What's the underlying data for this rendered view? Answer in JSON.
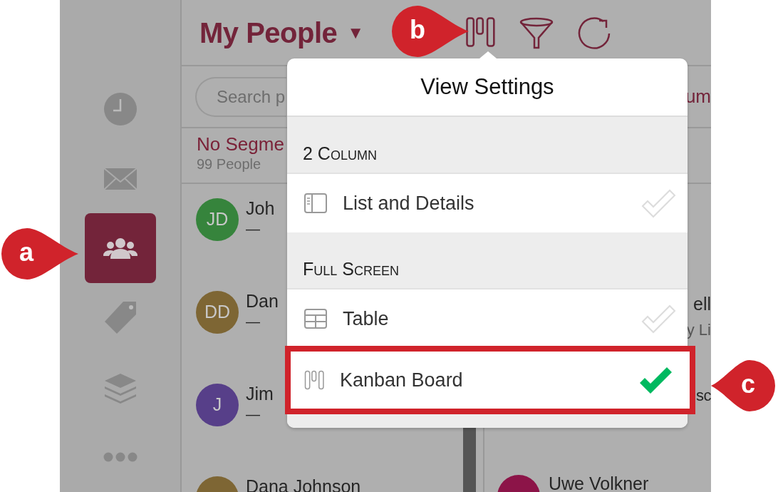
{
  "sidebar": {
    "items": [
      {
        "kind": "clock",
        "selected": false
      },
      {
        "kind": "mail",
        "selected": false
      },
      {
        "kind": "people",
        "selected": true
      },
      {
        "kind": "tag",
        "selected": false
      },
      {
        "kind": "layers",
        "selected": false
      },
      {
        "kind": "more",
        "selected": false
      }
    ]
  },
  "header": {
    "title": "My People",
    "caret": "▼",
    "toolbar": [
      {
        "kind": "kanban"
      },
      {
        "kind": "filter"
      },
      {
        "kind": "refresh"
      }
    ]
  },
  "search": {
    "placeholder": "Search p"
  },
  "search_row_column_2": "um",
  "segment": {
    "title": "No Segme",
    "count": "99 People"
  },
  "people": [
    {
      "name": "Joh",
      "initials": "JD",
      "color": "#36843c",
      "detail": "—"
    },
    {
      "name": "Dan",
      "initials": "DD",
      "color": "#7e6634",
      "detail": "—"
    },
    {
      "name": "Jim",
      "initials": "J",
      "color": "#573f89",
      "detail": "—"
    },
    {
      "name": "Dana Johnson",
      "color": "#7e6634"
    }
  ],
  "people_column_2": [
    {
      "name": "ell",
      "detail": "y Li"
    },
    {
      "name": "sc"
    },
    {
      "name": "Uwe Volkner",
      "color": "#8c1448"
    }
  ],
  "popover": {
    "title": "View Settings",
    "sections": [
      {
        "heading": "2 Column",
        "items": [
          {
            "kind": "list-details",
            "label": "List and Details",
            "selected": false,
            "highlighted": false
          }
        ]
      },
      {
        "heading": "Full Screen",
        "items": [
          {
            "kind": "table",
            "label": "Table",
            "selected": false,
            "highlighted": false
          },
          {
            "kind": "kanban",
            "label": "Kanban Board",
            "selected": true,
            "highlighted": true
          }
        ]
      }
    ]
  },
  "callouts": [
    {
      "label": "a",
      "kind": "right"
    },
    {
      "label": "b",
      "kind": "right"
    },
    {
      "label": "c",
      "kind": "left"
    }
  ]
}
